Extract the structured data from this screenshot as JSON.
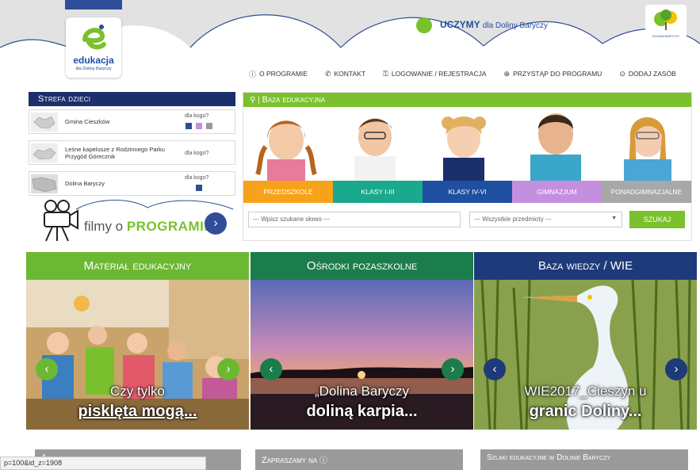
{
  "header": {
    "logo_name": "edukacja",
    "logo_sub": "dla Doliny Baryczy",
    "uczymy_main": "UCZYMY",
    "uczymy_rest": "dla Doliny Baryczy",
    "corner_logo_text": "DOLINA BARYCZY"
  },
  "topnav": [
    {
      "label": "O PROGRAMIE",
      "icon": "info-icon"
    },
    {
      "label": "KONTAKT",
      "icon": "phone-icon"
    },
    {
      "label": "LOGOWANIE / REJESTRACJA",
      "icon": "key-icon"
    },
    {
      "label": "PRZYSTĄP DO PROGRAMU",
      "icon": "plus-circle-icon"
    },
    {
      "label": "DODAJ ZASÓB",
      "icon": "add-circle-icon"
    }
  ],
  "strefa": {
    "title": "Strefa dzieci",
    "items": [
      {
        "name": "Gmina Cieszków",
        "dla_kogo": "dla kogo?",
        "colors": [
          "#2f4d98",
          "#c58fe0",
          "#9a9a9a"
        ]
      },
      {
        "name": "Leśne kapelusze z Rodzinnego Parku Przygód Górecznik",
        "dla_kogo": "dla kogo?",
        "colors": []
      },
      {
        "name": "Dolina Baryczy",
        "dla_kogo": "dla kogo?",
        "colors": [
          "#2f4d98"
        ]
      }
    ]
  },
  "filmy": {
    "part1": "filmy o ",
    "part2": "PROGRAMIE"
  },
  "baza": {
    "title": "Baza edukacyjna",
    "tabs": [
      {
        "label": "PRZEDSZKOLE",
        "color": "#f7a21b"
      },
      {
        "label": "KLASY I-III",
        "color": "#1aa98c"
      },
      {
        "label": "KLASY IV-VI",
        "color": "#1f4fa0"
      },
      {
        "label": "GIMNAZJUM",
        "color": "#c58fe0"
      },
      {
        "label": "PONADGIMNAZJALNE",
        "color": "#a8a8a8"
      }
    ],
    "search_placeholder": "--- Wpisz szukane słowo ---",
    "select_value": "--- Wszystkie przedmioty ---",
    "search_button": "SZUKAJ"
  },
  "panels": [
    {
      "title": "Materiał edukacyjny",
      "color": "#6cb832",
      "cap1": "Czy tylko",
      "cap2": "pisklęta mogą...",
      "nav_color": "#6cb832"
    },
    {
      "title": "Ośrodki pozaszkolne",
      "color": "#1c7d4c",
      "cap1": "„Dolina Baryczy",
      "cap2": "doliną karpia...",
      "nav_color": "#1c7d4c"
    },
    {
      "title": "Baza wiedzy / WIE",
      "color": "#1f3a7a",
      "cap1": "WIE2017_Cieszyn u",
      "cap2": "granic Doliny...",
      "nav_color": "#1f3a7a"
    }
  ],
  "bottom": {
    "col1": "A",
    "col2": "Zapraszamy na",
    "col3": "Szlaki edukacyjne w Dolinie Baryczy"
  },
  "status_url": "p=100&id_z=1908"
}
